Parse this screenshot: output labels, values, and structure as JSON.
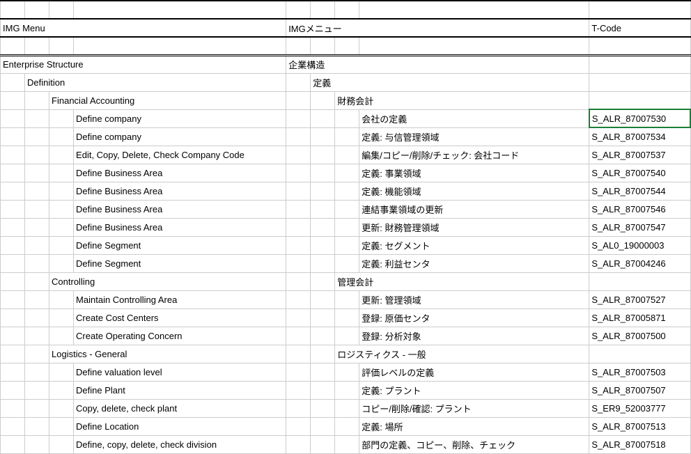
{
  "headers": {
    "left": "IMG Menu",
    "right": "IMGメニュー",
    "tcode": "T-Code"
  },
  "rows": [
    {
      "level": 0,
      "en": "Enterprise Structure",
      "jp": "企業構造",
      "tcode": ""
    },
    {
      "level": 1,
      "en": "Definition",
      "jp": "定義",
      "tcode": ""
    },
    {
      "level": 2,
      "en": "Financial Accounting",
      "jp": "財務会計",
      "tcode": ""
    },
    {
      "level": 3,
      "en": "Define company",
      "jp": "会社の定義",
      "tcode": "S_ALR_87007530",
      "selected": true
    },
    {
      "level": 3,
      "en": "Define company",
      "jp": "定義: 与信管理領域",
      "tcode": "S_ALR_87007534"
    },
    {
      "level": 3,
      "en": "Edit, Copy, Delete, Check Company Code",
      "jp": "編集/コピー/削除/チェック: 会社コード",
      "tcode": "S_ALR_87007537"
    },
    {
      "level": 3,
      "en": "Define Business Area",
      "jp": "定義: 事業領域",
      "tcode": "S_ALR_87007540"
    },
    {
      "level": 3,
      "en": "Define Business Area",
      "jp": "定義: 機能領域",
      "tcode": "S_ALR_87007544"
    },
    {
      "level": 3,
      "en": "Define Business Area",
      "jp": "連結事業領域の更新",
      "tcode": "S_ALR_87007546"
    },
    {
      "level": 3,
      "en": "Define Business Area",
      "jp": "更新: 財務管理領域",
      "tcode": "S_ALR_87007547"
    },
    {
      "level": 3,
      "en": "Define Segment",
      "jp": "定義: セグメント",
      "tcode": "S_AL0_19000003"
    },
    {
      "level": 3,
      "en": "Define Segment",
      "jp": "定義: 利益センタ",
      "tcode": "S_ALR_87004246"
    },
    {
      "level": 2,
      "en": "Controlling",
      "jp": "管理会計",
      "tcode": ""
    },
    {
      "level": 3,
      "en": "Maintain Controlling Area",
      "jp": "更新: 管理領域",
      "tcode": "S_ALR_87007527"
    },
    {
      "level": 3,
      "en": "Create Cost Centers",
      "jp": "登録: 原価センタ",
      "tcode": "S_ALR_87005871"
    },
    {
      "level": 3,
      "en": "Create Operating Concern",
      "jp": "登録: 分析対象",
      "tcode": "S_ALR_87007500"
    },
    {
      "level": 2,
      "en": "Logistics - General",
      "jp": "ロジスティクス - 一般",
      "tcode": ""
    },
    {
      "level": 3,
      "en": "Define valuation level",
      "jp": "評価レベルの定義",
      "tcode": "S_ALR_87007503"
    },
    {
      "level": 3,
      "en": "Define Plant",
      "jp": "定義: プラント",
      "tcode": "S_ALR_87007507"
    },
    {
      "level": 3,
      "en": "Copy, delete, check plant",
      "jp": "コピー/削除/確認: プラント",
      "tcode": "S_ER9_52003777"
    },
    {
      "level": 3,
      "en": "Define Location",
      "jp": "定義: 場所",
      "tcode": "S_ALR_87007513"
    },
    {
      "level": 3,
      "en": "Define, copy, delete, check division",
      "jp": "部門の定義、コピー、削除、チェック",
      "tcode": "S_ALR_87007518"
    }
  ]
}
